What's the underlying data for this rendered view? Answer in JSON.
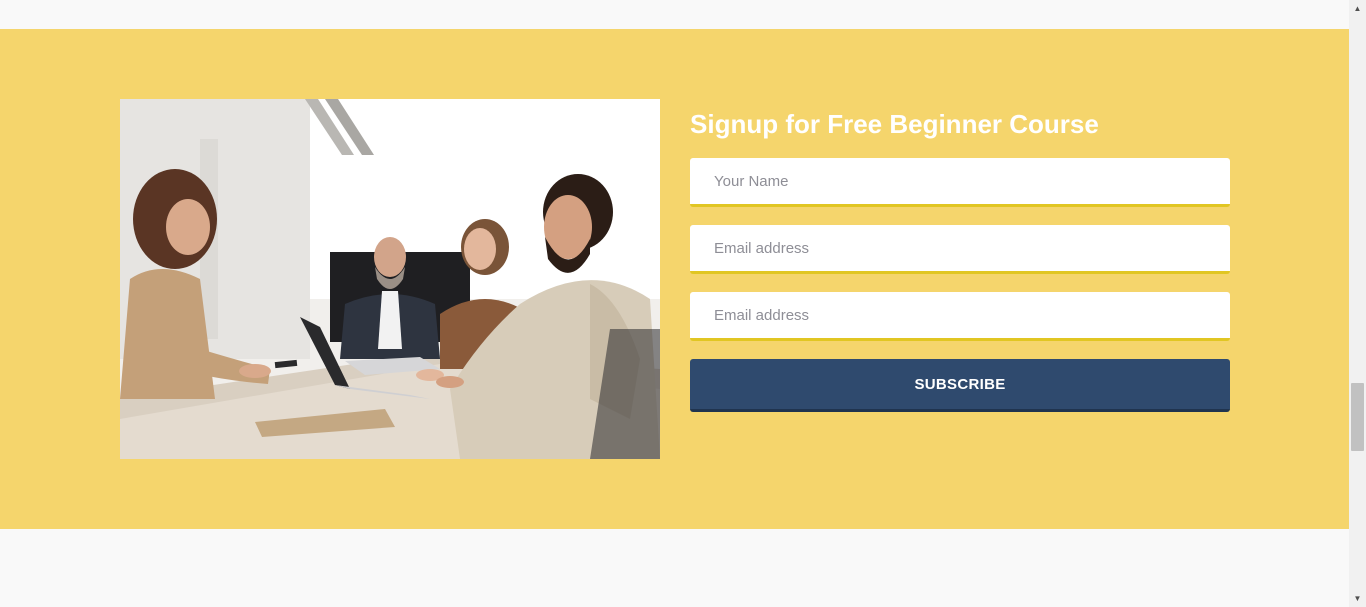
{
  "signup": {
    "heading": "Signup for Free Beginner Course",
    "name_placeholder": "Your Name",
    "email_placeholder": "Email address",
    "email2_placeholder": "Email address",
    "subscribe_label": "SUBSCRIBE"
  },
  "image": {
    "description": "people-at-meeting-table-photo"
  },
  "colors": {
    "band": "#f5d56c",
    "button": "#2f4a6e",
    "field_underline": "#e1c623",
    "heading": "#ffffff"
  },
  "scrollbar": {
    "up_icon": "▲",
    "down_icon": "▼"
  }
}
